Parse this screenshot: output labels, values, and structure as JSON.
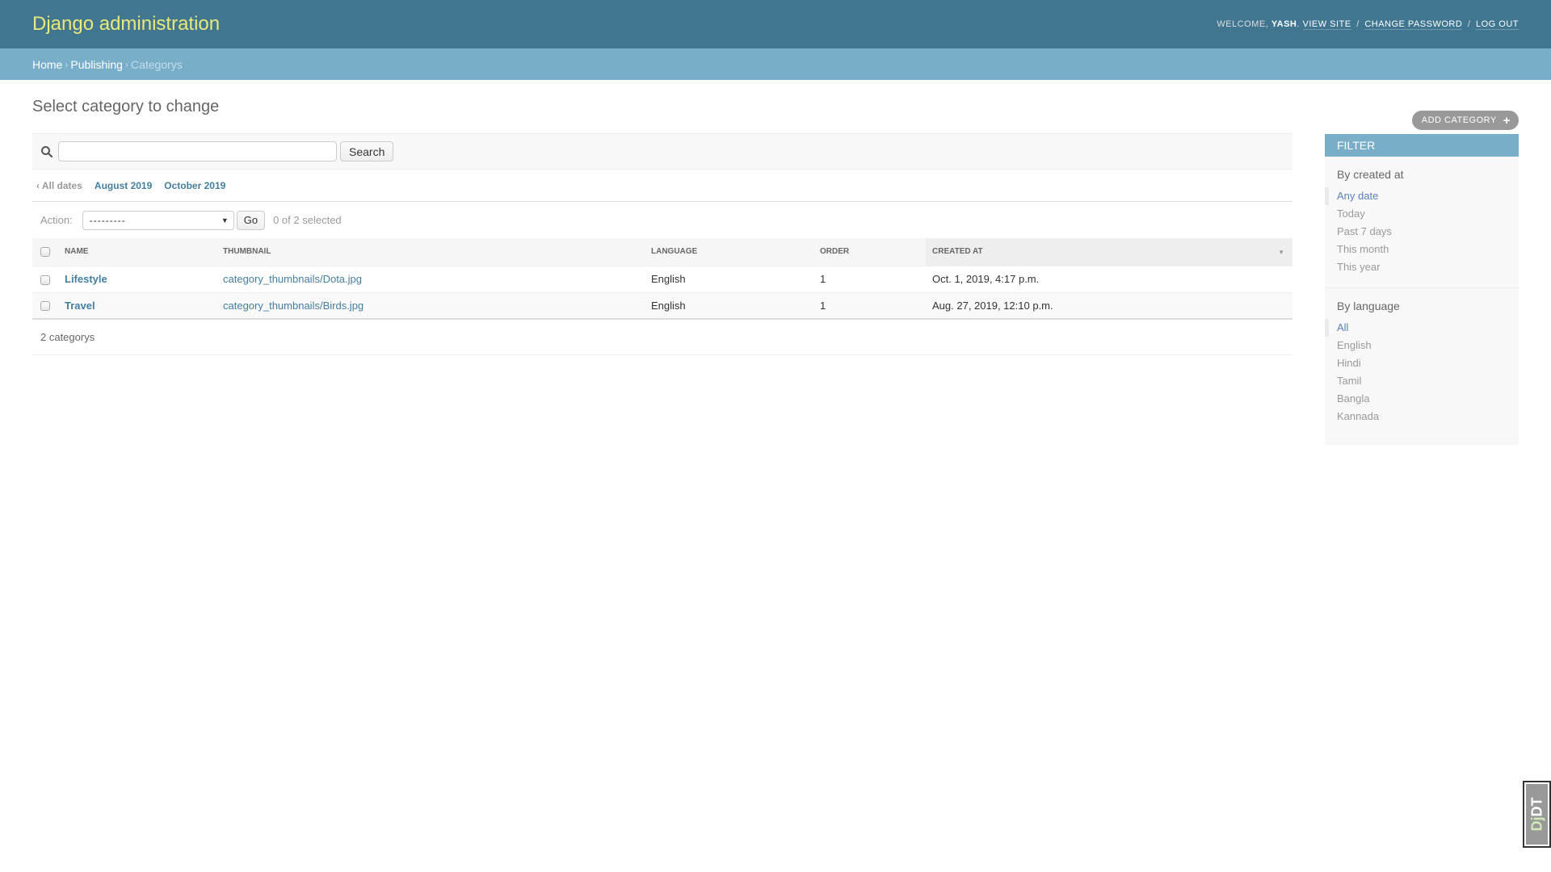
{
  "header": {
    "branding": "Django administration",
    "welcome": "Welcome,",
    "username": "Yash",
    "view_site": "View site",
    "change_password": "Change password",
    "log_out": "Log out",
    "separator": "/"
  },
  "breadcrumbs": [
    {
      "label": "Home"
    },
    {
      "label": "Publishing"
    },
    {
      "label": "Categorys"
    }
  ],
  "breadcrumb_separator": "›",
  "page": {
    "title": "Select category to change",
    "add_button": "Add category",
    "add_icon": "+"
  },
  "search": {
    "icon": "search-icon",
    "placeholder": "",
    "value": "",
    "button": "Search"
  },
  "date_hierarchy": {
    "all_dates": "‹ All dates",
    "items": [
      "August 2019",
      "October 2019"
    ]
  },
  "actions": {
    "label": "Action:",
    "selected_option": "---------",
    "go": "Go",
    "counter": "0 of 2 selected"
  },
  "table": {
    "columns": [
      "Name",
      "Thumbnail",
      "Language",
      "Order",
      "Created at"
    ],
    "sorted_column": "Created at",
    "rows": [
      {
        "name": "Lifestyle",
        "thumbnail": "category_thumbnails/Dota.jpg",
        "language": "English",
        "order": "1",
        "created_at": "Oct. 1, 2019, 4:17 p.m."
      },
      {
        "name": "Travel",
        "thumbnail": "category_thumbnails/Birds.jpg",
        "language": "English",
        "order": "1",
        "created_at": "Aug. 27, 2019, 12:10 p.m."
      }
    ]
  },
  "paginator": "2 categorys",
  "filter": {
    "title": "Filter",
    "sections": [
      {
        "title": "By created at",
        "selected": "Any date",
        "options": [
          "Any date",
          "Today",
          "Past 7 days",
          "This month",
          "This year"
        ]
      },
      {
        "title": "By language",
        "selected": "All",
        "options": [
          "All",
          "English",
          "Hindi",
          "Tamil",
          "Bangla",
          "Kannada"
        ]
      }
    ]
  },
  "debug_toolbar": {
    "prefix": "Dj",
    "suffix": "DT"
  },
  "colors": {
    "header_bg": "#417690",
    "breadcrumb_bg": "#79aec8",
    "branding": "#e9e979",
    "link": "#447e9b"
  }
}
